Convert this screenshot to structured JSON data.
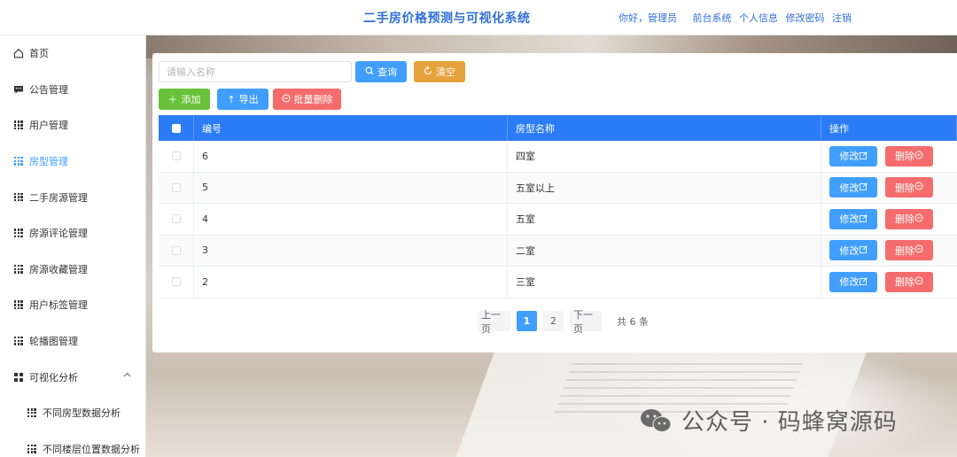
{
  "header": {
    "title": "二手房价格预测与可视化系统",
    "greeting": "你好，管理员",
    "links": [
      "前台系统",
      "个人信息",
      "修改密码",
      "注销"
    ]
  },
  "sidebar": {
    "items": [
      {
        "label": "首页",
        "icon": "home-icon"
      },
      {
        "label": "公告管理",
        "icon": "message-icon"
      },
      {
        "label": "用户管理",
        "icon": "grid-icon"
      },
      {
        "label": "房型管理",
        "icon": "grid-icon",
        "active": true
      },
      {
        "label": "二手房源管理",
        "icon": "grid-icon"
      },
      {
        "label": "房源评论管理",
        "icon": "grid-icon"
      },
      {
        "label": "房源收藏管理",
        "icon": "grid-icon"
      },
      {
        "label": "用户标签管理",
        "icon": "grid-icon"
      },
      {
        "label": "轮播图管理",
        "icon": "grid-icon"
      },
      {
        "label": "可视化分析",
        "icon": "menu-icon",
        "expanded": true
      },
      {
        "label": "不同房型数据分析",
        "icon": "grid-icon",
        "sub": true
      },
      {
        "label": "不同楼层位置数据分析",
        "icon": "grid-icon",
        "sub": true
      }
    ]
  },
  "toolbar": {
    "search_placeholder": "请输入名称",
    "query_label": "查询",
    "clear_label": "清空",
    "add_label": "添加",
    "export_label": "导出",
    "batch_delete_label": "批量删除"
  },
  "table": {
    "headers": [
      "编号",
      "房型名称",
      "操作"
    ],
    "rows": [
      {
        "id": "6",
        "name": "四室"
      },
      {
        "id": "5",
        "name": "五室以上"
      },
      {
        "id": "4",
        "name": "五室"
      },
      {
        "id": "3",
        "name": "二室"
      },
      {
        "id": "2",
        "name": "三室"
      }
    ],
    "edit_label": "修改",
    "delete_label": "删除"
  },
  "pagination": {
    "prev_label": "上一页",
    "pages": [
      "1",
      "2"
    ],
    "current": "1",
    "next_label": "下一页",
    "total_text": "共 6 条"
  },
  "watermark": {
    "text": "公众号 · 码蜂窝源码"
  },
  "colors": {
    "primary": "#409eff",
    "header_title": "#2f6fd8",
    "table_header": "#2b7cf6",
    "success": "#67c23a",
    "warning": "#e6a23c",
    "danger": "#f56c6c"
  }
}
